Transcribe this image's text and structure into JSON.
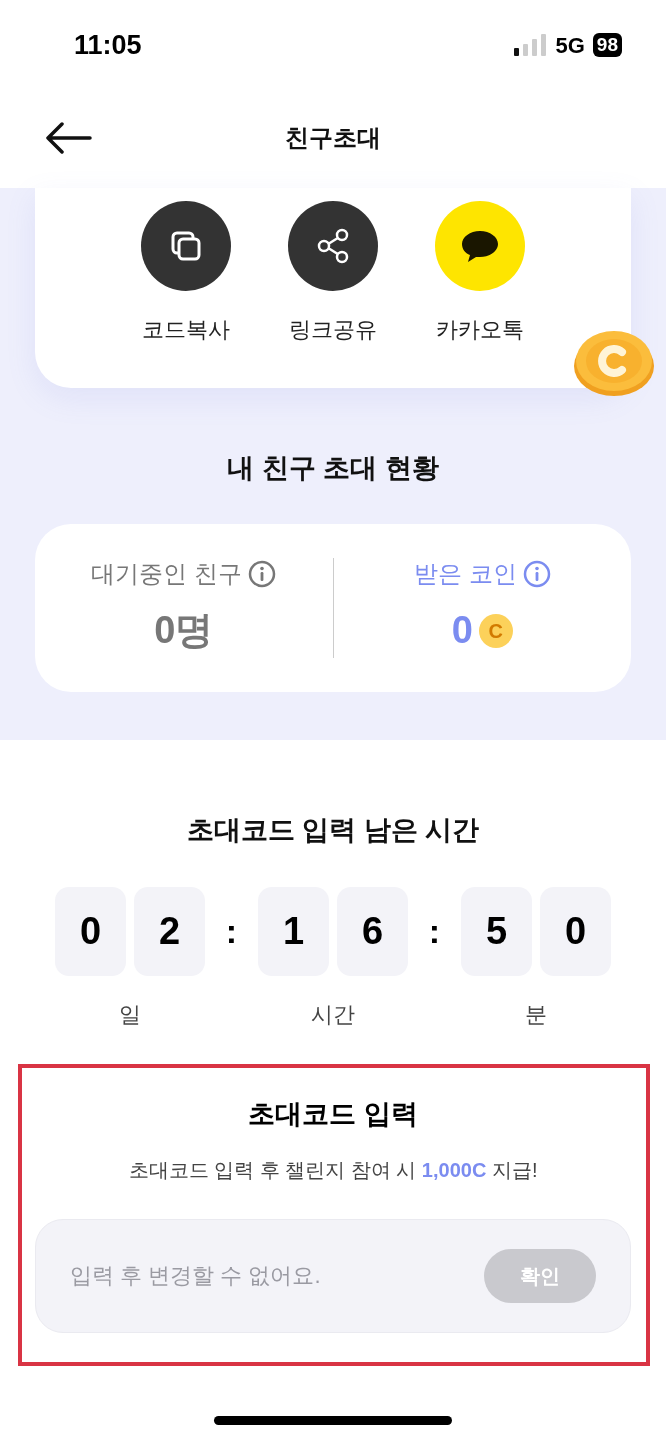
{
  "status_bar": {
    "time": "11:05",
    "network": "5G",
    "battery": "98"
  },
  "header": {
    "title": "친구초대"
  },
  "share_buttons": [
    {
      "kind": "copy",
      "label": "코드복사"
    },
    {
      "kind": "share",
      "label": "링크공유"
    },
    {
      "kind": "kakao",
      "label": "카카오톡"
    }
  ],
  "status_section": {
    "title": "내 친구 초대 현황",
    "stats": [
      {
        "kind": "pending",
        "label": "대기중인 친구",
        "value": "0명"
      },
      {
        "kind": "coins",
        "label": "받은 코인",
        "value": "0",
        "coin_mark": "C"
      }
    ]
  },
  "timer": {
    "title": "초대코드 입력 남은 시간",
    "groups": [
      {
        "digits": [
          "0",
          "2"
        ],
        "unit": "일"
      },
      {
        "digits": [
          "1",
          "6"
        ],
        "unit": "시간"
      },
      {
        "digits": [
          "5",
          "0"
        ],
        "unit": "분"
      }
    ],
    "separators": [
      ":",
      ":"
    ]
  },
  "invite_code": {
    "title": "초대코드 입력",
    "subtitle": "초대코드 입력 후 챌린지 참여 시 **1,000C** 지급!",
    "placeholder": "입력 후 변경할 수 없어요.",
    "button": {
      "label": "확인",
      "disabled": true
    }
  }
}
